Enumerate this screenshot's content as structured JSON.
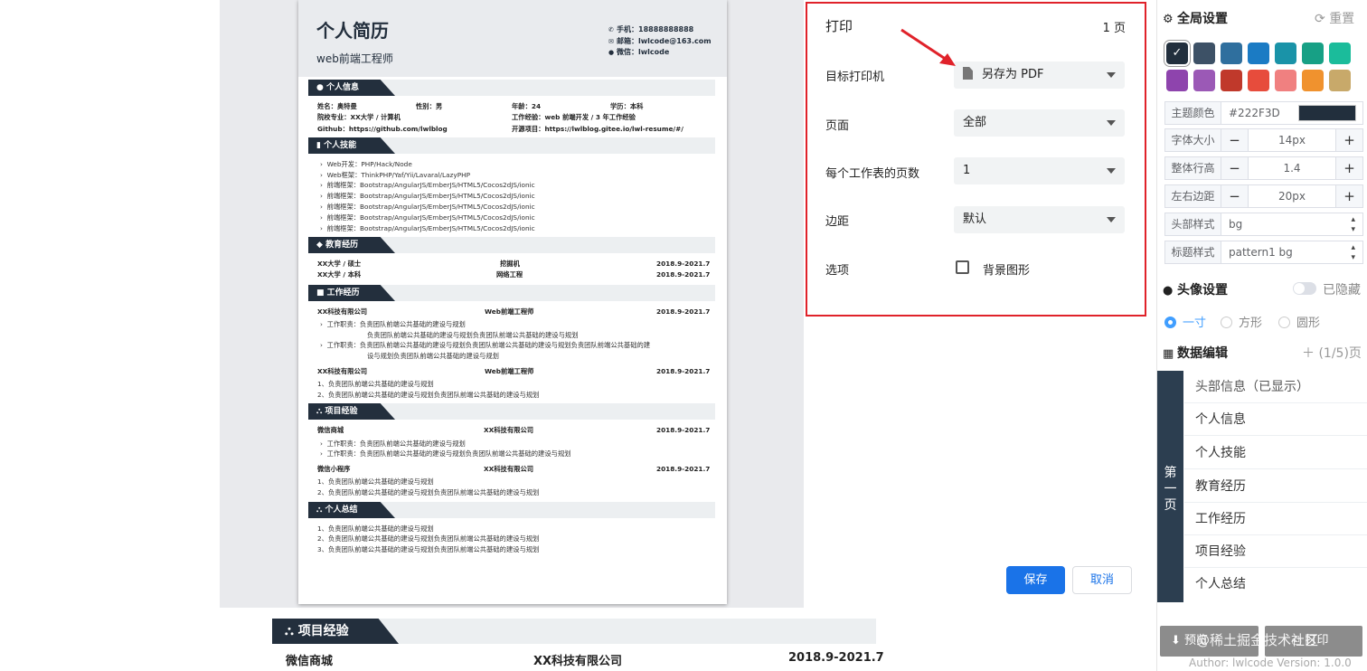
{
  "resume": {
    "name": "个人简历",
    "role": "web前端工程师",
    "contacts": [
      {
        "icon": "phone-icon",
        "text": "手机：18888888888"
      },
      {
        "icon": "mail-icon",
        "text": "邮箱：lwlcode@163.com"
      },
      {
        "icon": "wechat-icon",
        "text": "微信：lwlcode"
      }
    ],
    "sections": {
      "info": "个人信息",
      "skills": "个人技能",
      "education": "教育经历",
      "work": "工作经历",
      "projects": "项目经验",
      "summary": "个人总结"
    },
    "info_rows": [
      [
        "姓名：奥特曼",
        "性别：男",
        "年龄：24",
        "学历：本科"
      ],
      [
        "院校专业：XX大学 / 计算机",
        "",
        "工作经验：web 前端开发 / 3 年工作经验",
        ""
      ],
      [
        "Github：https://github.com/lwlblog",
        "",
        "开源项目：https://lwlblog.gitee.io/lwl-resume/#/",
        ""
      ]
    ],
    "skills": [
      "Web开发：PHP/Hack/Node",
      "Web框架：ThinkPHP/Yaf/Yii/Lavaral/LazyPHP",
      "前端框架：Bootstrap/AngularJS/EmberJS/HTML5/Cocos2dJS/ionic",
      "前端框架：Bootstrap/AngularJS/EmberJS/HTML5/Cocos2dJS/ionic",
      "前端框架：Bootstrap/AngularJS/EmberJS/HTML5/Cocos2dJS/ionic",
      "前端框架：Bootstrap/AngularJS/EmberJS/HTML5/Cocos2dJS/ionic",
      "前端框架：Bootstrap/AngularJS/EmberJS/HTML5/Cocos2dJS/ionic"
    ],
    "education": [
      {
        "school": "XX大学 / 硕士",
        "major": "挖掘机",
        "date": "2018.9-2021.7"
      },
      {
        "school": "XX大学 / 本科",
        "major": "网络工程",
        "date": "2018.9-2021.7"
      }
    ],
    "work1": {
      "company": "XX科技有限公司",
      "title": "Web前端工程师",
      "date": "2018.9-2021.7",
      "lines": [
        "工作职责：负责团队前端公共基础的建设与规划",
        "负责团队前端公共基础的建设与规划负责团队前端公共基础的建设与规划",
        "工作职责：负责团队前端公共基础的建设与规划负责团队前端公共基础的建设与规划负责团队前端公共基础的建",
        "设与规划负责团队前端公共基础的建设与规划"
      ]
    },
    "work2": {
      "company": "XX科技有限公司",
      "title": "Web前端工程师",
      "date": "2018.9-2021.7",
      "lines": [
        "1、负责团队前端公共基础的建设与规划",
        "2、负责团队前端公共基础的建设与规划负责团队前端公共基础的建设与规划"
      ]
    },
    "proj1": {
      "name": "微信商城",
      "company": "XX科技有限公司",
      "date": "2018.9-2021.7",
      "lines": [
        "工作职责：负责团队前端公共基础的建设与规划",
        "工作职责：负责团队前端公共基础的建设与规划负责团队前端公共基础的建设与规划"
      ]
    },
    "proj2": {
      "name": "微信小程序",
      "company": "XX科技有限公司",
      "date": "2018.9-2021.7",
      "lines": [
        "1、负责团队前端公共基础的建设与规划",
        "2、负责团队前端公共基础的建设与规划负责团队前端公共基础的建设与规划"
      ]
    },
    "summary_lines": [
      "1、负责团队前端公共基础的建设与规划",
      "2、负责团队前端公共基础的建设与规划负责团队前端公共基础的建设与规划",
      "3、负责团队前端公共基础的建设与规划负责团队前端公共基础的建设与规划"
    ]
  },
  "background_resume": {
    "section": "项目经验",
    "name": "微信商城",
    "company": "XX科技有限公司",
    "date": "2018.9-2021.7"
  },
  "print_dialog": {
    "title": "打印",
    "pages": "1 页",
    "printer_label": "目标打印机",
    "printer_value": "另存为 PDF",
    "page_label": "页面",
    "page_value": "全部",
    "per_sheet_label": "每个工作表的页数",
    "per_sheet_value": "1",
    "margin_label": "边距",
    "margin_value": "默认",
    "options_label": "选项",
    "bg_graphics_label": "背景图形",
    "bg_graphics_checked": false,
    "save_label": "保存",
    "cancel_label": "取消"
  },
  "sidebar": {
    "global_title": "全局设置",
    "reset_label": "重置",
    "swatches": [
      "#222f3d",
      "#3d5166",
      "#2f6f9e",
      "#1b7bc4",
      "#1a93a8",
      "#17a085",
      "#1bbc9b",
      "#8e44ad",
      "#9b59b6",
      "#c0392b",
      "#e74c3c",
      "#f08080",
      "#f0922e",
      "#c8a96a"
    ],
    "theme_color_label": "主题颜色",
    "theme_color_value": "#222F3D",
    "theme_color": "#222f3d",
    "font_size_label": "字体大小",
    "font_size_value": "14px",
    "line_height_label": "整体行高",
    "line_height_value": "1.4",
    "padding_label": "左右边距",
    "padding_value": "20px",
    "header_style_label": "头部样式",
    "header_style_value": "bg",
    "title_style_label": "标题样式",
    "title_style_value": "pattern1 bg",
    "avatar_title": "头像设置",
    "hide_label": "已隐藏",
    "avatar_options": [
      "一寸",
      "方形",
      "圆形"
    ],
    "data_title": "数据编辑",
    "data_count": "(1/5)页",
    "page_tab": "第一页",
    "modules": [
      "头部信息（已显示）",
      "个人信息",
      "个人技能",
      "教育经历",
      "工作经历",
      "项目经验",
      "个人总结"
    ],
    "btn1": "预览",
    "btn2": "打印",
    "watermark": "@稀土掘金技术社区",
    "version": "Author: lwlcode Version: 1.0.0"
  }
}
